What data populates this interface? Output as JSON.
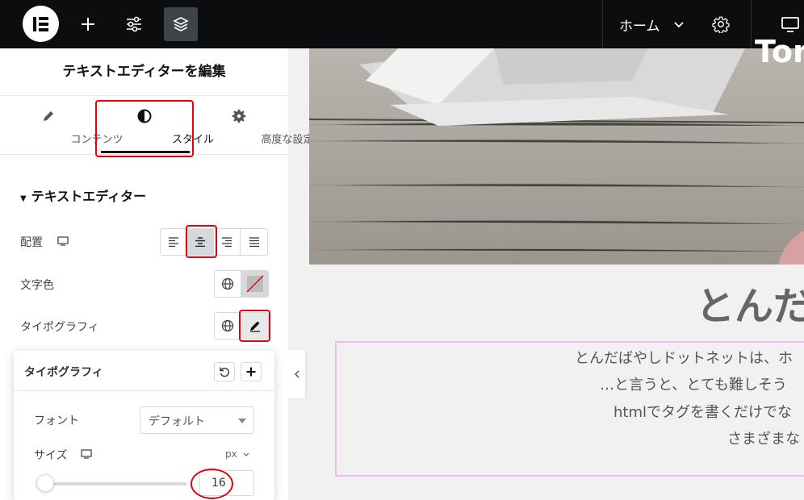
{
  "topbar": {
    "home_label": "ホーム"
  },
  "panel": {
    "title": "テキストエディターを編集",
    "tabs": [
      {
        "label": "コンテンツ",
        "icon": "pencil-icon"
      },
      {
        "label": "スタイル",
        "icon": "contrast-icon"
      },
      {
        "label": "高度な設定",
        "icon": "gear-icon"
      }
    ],
    "active_tab": "スタイル",
    "section_title": "テキストエディター",
    "controls": {
      "align_label": "配置",
      "color_label": "文字色",
      "typography_label": "タイポグラフィ"
    }
  },
  "popover": {
    "title": "タイポグラフィ",
    "font_label": "フォント",
    "font_value": "デフォルト",
    "size_label": "サイズ",
    "unit": "px",
    "size_value": "16"
  },
  "preview": {
    "top_text": "Tor",
    "heading": "とんだ",
    "lines": [
      "とんだばやしドットネットは、ホ",
      "…と言うと、とても難しそう",
      "htmlでタグを書くだけでな",
      "さまざまな"
    ]
  },
  "colors": {
    "accent_red": "#e3000f",
    "topbar_bg": "#0c0d0e",
    "editor_outline": "#f0b9f0"
  }
}
